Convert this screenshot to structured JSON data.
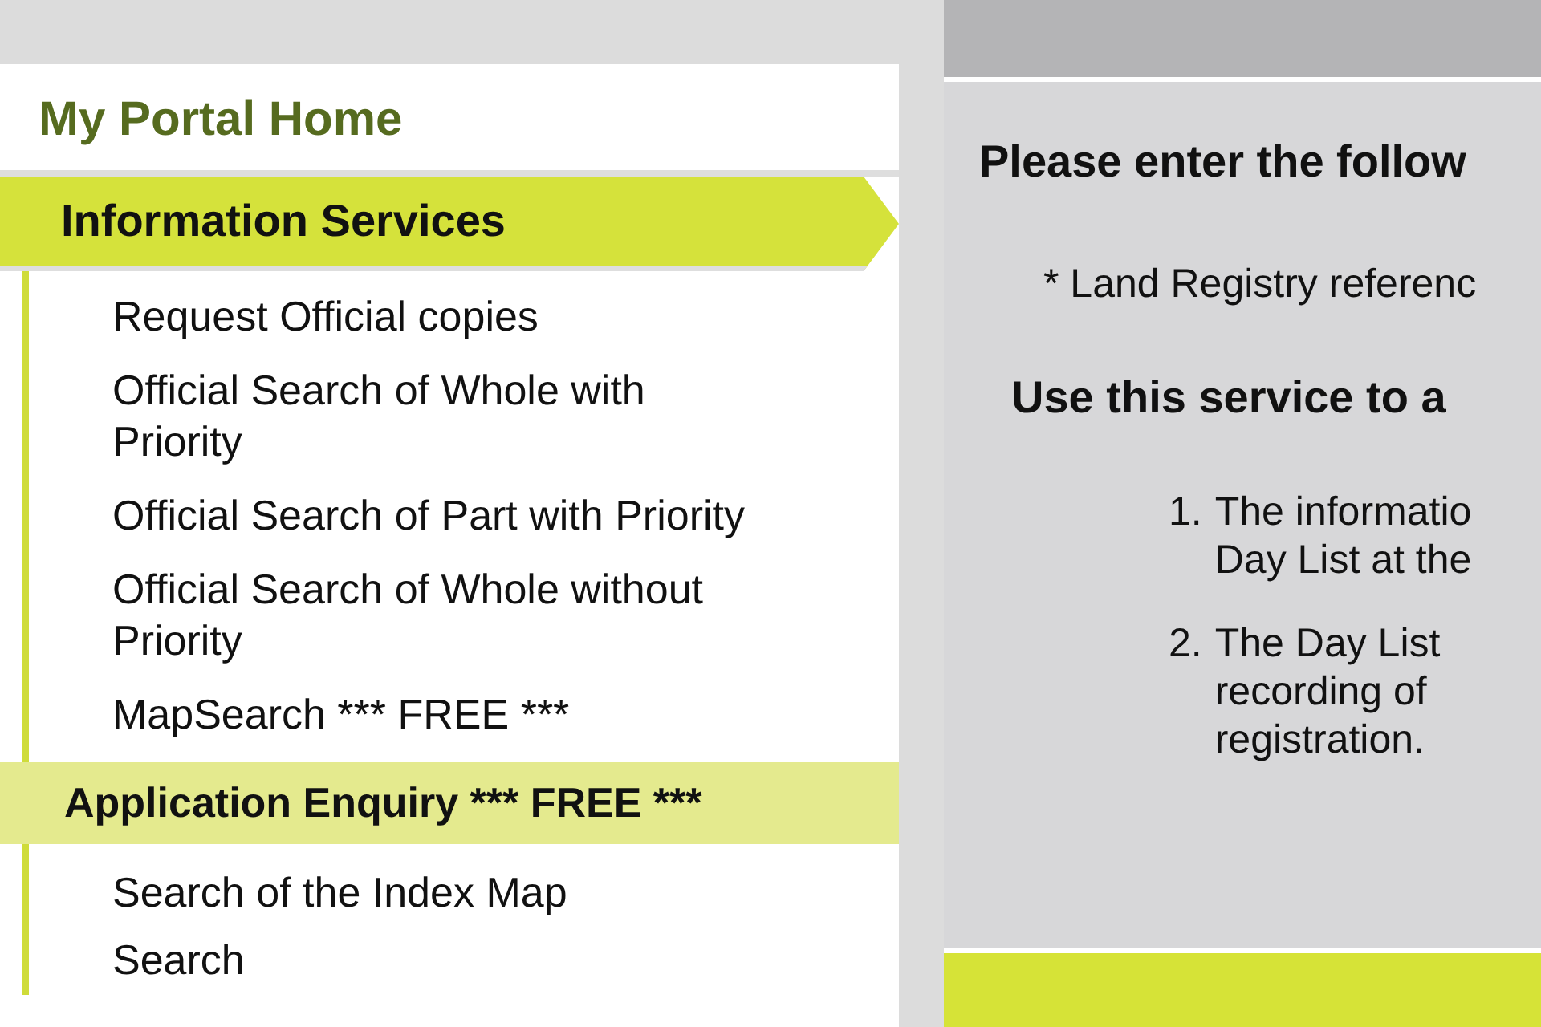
{
  "nav": {
    "home_link": "My Portal Home",
    "sections": [
      {
        "title": "Information Services",
        "selected": true,
        "items": [
          "Request Official copies",
          "Official Search of Whole with Priority",
          "Official Search of Part with Priority",
          "Official Search of Whole without Priority",
          "MapSearch *** FREE ***"
        ]
      },
      {
        "title": "Application Enquiry *** FREE ***",
        "selected": false,
        "items": [
          "Search of the Index Map",
          "Search"
        ]
      }
    ]
  },
  "content": {
    "heading": "Please enter the follow",
    "note": "* Land Registry referenc",
    "subheading": "Use this service to a",
    "steps": [
      {
        "number": "1.",
        "lines": [
          "The informatio",
          "Day List at the"
        ]
      },
      {
        "number": "2.",
        "lines": [
          "The Day List",
          "recording of",
          "registration."
        ]
      }
    ]
  }
}
